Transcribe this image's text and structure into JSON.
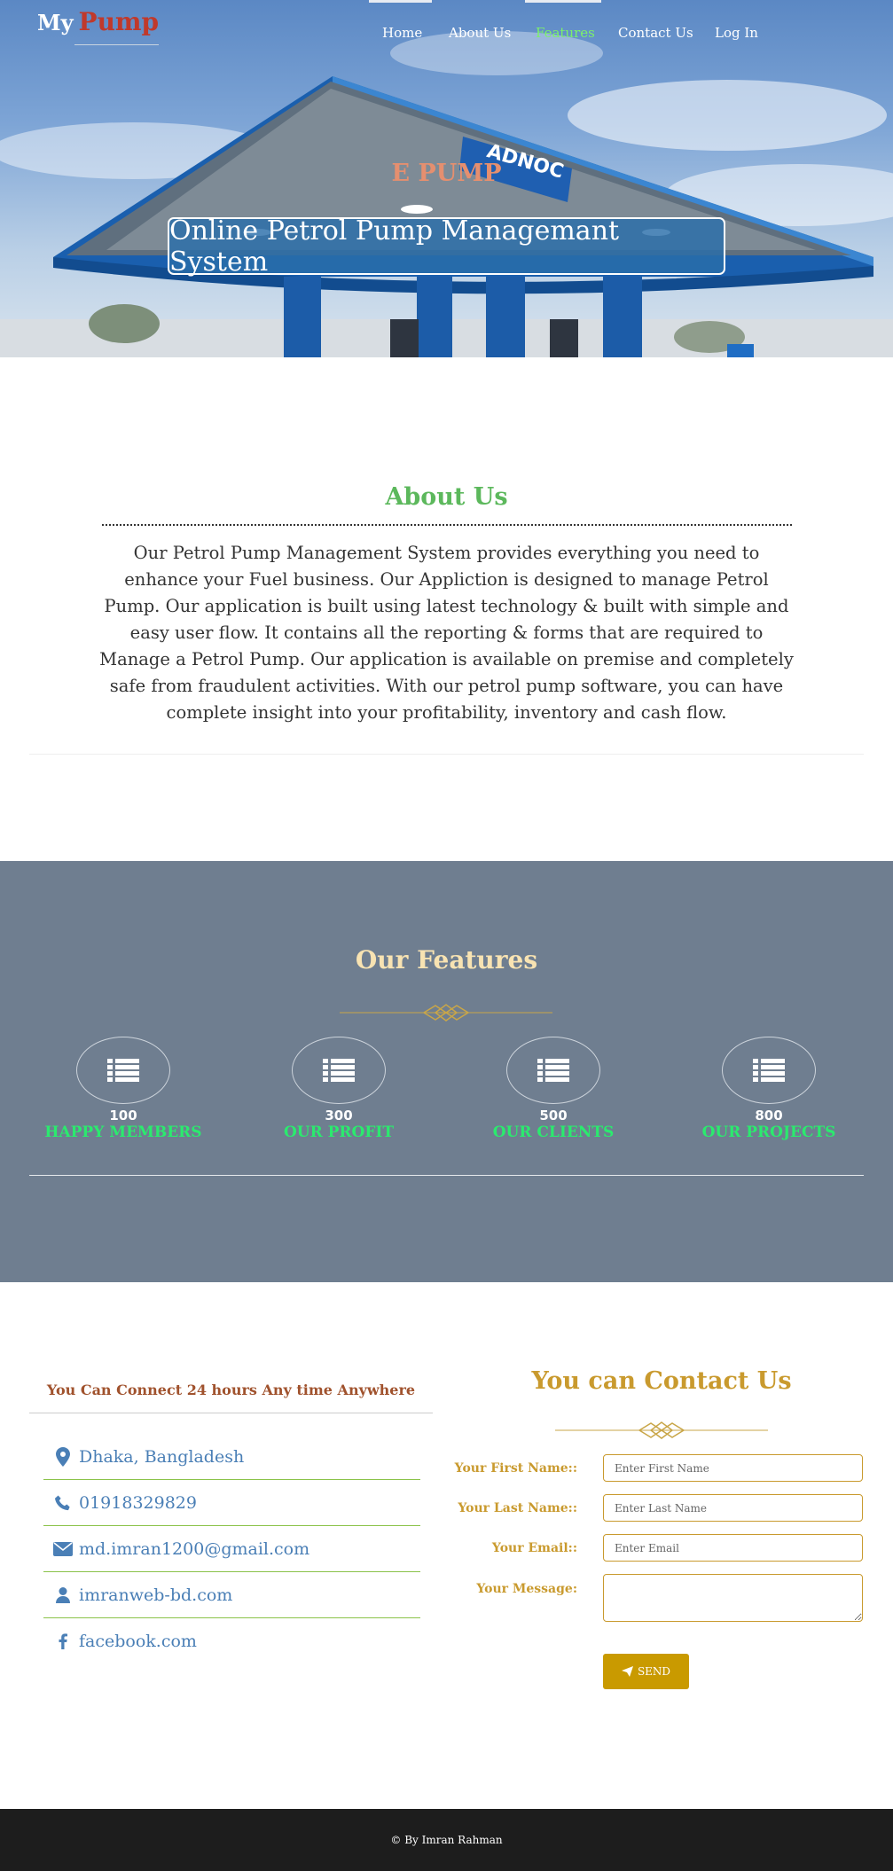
{
  "header": {
    "logo_my": "My",
    "logo_pump": "Pump",
    "nav": [
      {
        "label": "Home",
        "active": false
      },
      {
        "label": "About Us",
        "active": false
      },
      {
        "label": "Features",
        "active": true
      },
      {
        "label": "Contact Us",
        "active": false
      },
      {
        "label": "Log In",
        "active": false
      }
    ]
  },
  "hero": {
    "brand_sign": "ADNOC",
    "title": "E PUMP",
    "subtitle": "Online Petrol Pump Managemant System"
  },
  "about": {
    "title": "About Us",
    "text": "Our Petrol Pump Management System provides everything you need to enhance your Fuel business. Our Appliction is designed to manage Petrol Pump. Our application is built using latest technology & built with simple and easy user flow. It contains all the reporting & forms that are required to Manage a Petrol Pump. Our application is available on premise and completely safe from fraudulent activities. With our petrol pump software, you can have complete insight into your profitability, inventory and cash flow."
  },
  "features": {
    "title": "Our Features",
    "items": [
      {
        "icon": "list-icon",
        "number": "100",
        "label": "HAPPY MEMBERS"
      },
      {
        "icon": "list-icon",
        "number": "300",
        "label": "OUR PROFIT"
      },
      {
        "icon": "list-icon",
        "number": "500",
        "label": "OUR CLIENTS"
      },
      {
        "icon": "list-icon",
        "number": "800",
        "label": "OUR PROJECTS"
      }
    ]
  },
  "connect": {
    "title": "You Can Connect 24 hours Any time Anywhere",
    "items": [
      {
        "icon": "map-marker-icon",
        "text": "Dhaka, Bangladesh"
      },
      {
        "icon": "phone-icon",
        "text": "01918329829"
      },
      {
        "icon": "envelope-icon",
        "text": "md.imran1200@gmail.com"
      },
      {
        "icon": "user-icon",
        "text": "imranweb-bd.com"
      },
      {
        "icon": "facebook-icon",
        "text": "facebook.com"
      }
    ]
  },
  "contact_form": {
    "title": "You can Contact Us",
    "first_name_label": "Your First Name::",
    "first_name_placeholder": "Enter First Name",
    "last_name_label": "Your Last Name::",
    "last_name_placeholder": "Enter Last Name",
    "email_label": "Your Email::",
    "email_placeholder": "Enter Email",
    "message_label": "Your Message:",
    "send_label": "SEND"
  },
  "footer": {
    "text": "© By Imran Rahman"
  },
  "colors": {
    "features_bg": "#6f7e90",
    "feature_label": "#2bea6e",
    "accent_gold": "#c99a2e",
    "about_title": "#5cb85c",
    "nav_active": "#7cf06b",
    "footer_bg": "#1d1d1d"
  }
}
